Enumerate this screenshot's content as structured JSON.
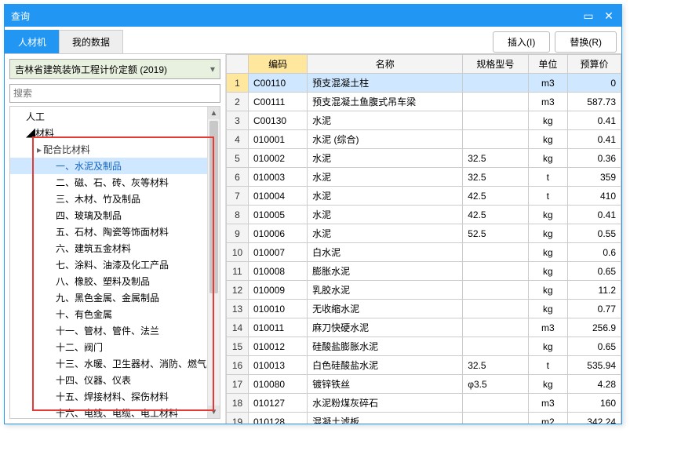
{
  "window": {
    "title": "查询"
  },
  "tabs": [
    {
      "label": "人材机",
      "active": true
    },
    {
      "label": "我的数据",
      "active": false
    }
  ],
  "buttons": {
    "insert": "插入(I)",
    "replace": "替换(R)"
  },
  "left": {
    "combo": "吉林省建筑装饰工程计价定额 (2019)",
    "search_placeholder": "搜索",
    "tree": {
      "root1": "人工",
      "root2": "材料",
      "group": "配合比材料",
      "items": [
        "一、水泥及制品",
        "二、磁、石、砖、灰等材料",
        "三、木材、竹及制品",
        "四、玻璃及制品",
        "五、石材、陶瓷等饰面材料",
        "六、建筑五金材料",
        "七、涂料、油漆及化工产品",
        "八、橡胶、塑料及制品",
        "九、黑色金属、金属制品",
        "十、有色金属",
        "十一、管材、管件、法兰",
        "十二、阀门",
        "十三、水暖、卫生器材、消防、燃气具",
        "十四、仪器、仪表",
        "十五、焊接材料、探伤材料",
        "十六、电线、电缆、电工材料"
      ],
      "selected": 0
    }
  },
  "grid": {
    "headers": [
      "编码",
      "名称",
      "规格型号",
      "单位",
      "预算价"
    ],
    "rows": [
      {
        "n": 1,
        "code": "C00110",
        "name": "预支混凝土柱",
        "spec": "",
        "unit": "m3",
        "price": "0"
      },
      {
        "n": 2,
        "code": "C00111",
        "name": "预支混凝土鱼腹式吊车梁",
        "spec": "",
        "unit": "m3",
        "price": "587.73"
      },
      {
        "n": 3,
        "code": "C00130",
        "name": "水泥",
        "spec": "",
        "unit": "kg",
        "price": "0.41"
      },
      {
        "n": 4,
        "code": "010001",
        "name": "水泥 (综合)",
        "spec": "",
        "unit": "kg",
        "price": "0.41"
      },
      {
        "n": 5,
        "code": "010002",
        "name": "水泥",
        "spec": "32.5",
        "unit": "kg",
        "price": "0.36"
      },
      {
        "n": 6,
        "code": "010003",
        "name": "水泥",
        "spec": "32.5",
        "unit": "t",
        "price": "359"
      },
      {
        "n": 7,
        "code": "010004",
        "name": "水泥",
        "spec": "42.5",
        "unit": "t",
        "price": "410"
      },
      {
        "n": 8,
        "code": "010005",
        "name": "水泥",
        "spec": "42.5",
        "unit": "kg",
        "price": "0.41"
      },
      {
        "n": 9,
        "code": "010006",
        "name": "水泥",
        "spec": "52.5",
        "unit": "kg",
        "price": "0.55"
      },
      {
        "n": 10,
        "code": "010007",
        "name": "白水泥",
        "spec": "",
        "unit": "kg",
        "price": "0.6"
      },
      {
        "n": 11,
        "code": "010008",
        "name": "膨胀水泥",
        "spec": "",
        "unit": "kg",
        "price": "0.65"
      },
      {
        "n": 12,
        "code": "010009",
        "name": "乳胶水泥",
        "spec": "",
        "unit": "kg",
        "price": "11.2"
      },
      {
        "n": 13,
        "code": "010010",
        "name": "无收缩水泥",
        "spec": "",
        "unit": "kg",
        "price": "0.77"
      },
      {
        "n": 14,
        "code": "010011",
        "name": "麻刀快硬水泥",
        "spec": "",
        "unit": "m3",
        "price": "256.9"
      },
      {
        "n": 15,
        "code": "010012",
        "name": "硅酸盐膨胀水泥",
        "spec": "",
        "unit": "kg",
        "price": "0.65"
      },
      {
        "n": 16,
        "code": "010013",
        "name": "白色硅酸盐水泥",
        "spec": "32.5",
        "unit": "t",
        "price": "535.94"
      },
      {
        "n": 17,
        "code": "010080",
        "name": "镀锌铁丝",
        "spec": "φ3.5",
        "unit": "kg",
        "price": "4.28"
      },
      {
        "n": 18,
        "code": "010127",
        "name": "水泥粉煤灰碎石",
        "spec": "",
        "unit": "m3",
        "price": "160"
      },
      {
        "n": 19,
        "code": "010128",
        "name": "混凝土滤板",
        "spec": "",
        "unit": "m2",
        "price": "342.24"
      }
    ],
    "selected": 0
  }
}
